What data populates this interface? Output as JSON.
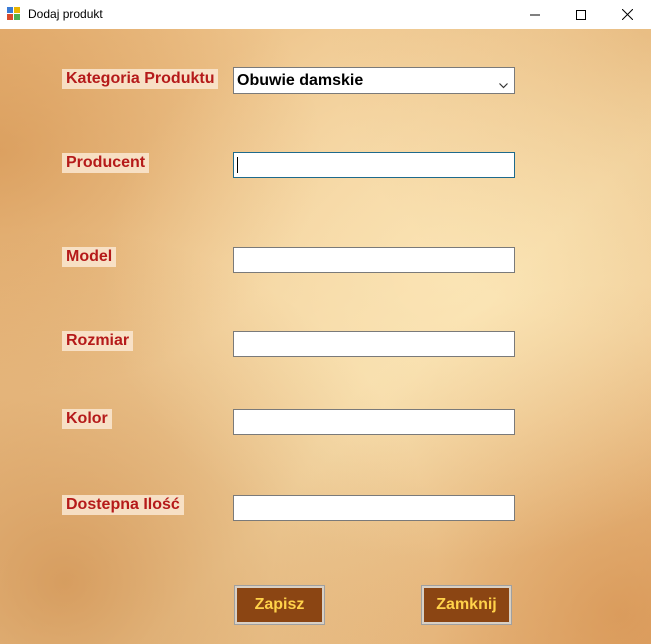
{
  "window": {
    "title": "Dodaj produkt"
  },
  "form": {
    "category": {
      "label": "Kategoria Produktu",
      "selected": "Obuwie damskie"
    },
    "producer": {
      "label": "Producent",
      "value": ""
    },
    "model": {
      "label": "Model",
      "value": ""
    },
    "size": {
      "label": "Rozmiar",
      "value": ""
    },
    "color": {
      "label": "Kolor",
      "value": ""
    },
    "quantity": {
      "label": "Dostepna Ilość",
      "value": ""
    }
  },
  "buttons": {
    "save": "Zapisz",
    "close": "Zamknij"
  },
  "colors": {
    "label_text": "#b51a1a",
    "button_bg": "#8b4513",
    "button_text": "#ffd24a"
  },
  "icons": {
    "app": "app-icon",
    "minimize": "minimize-icon",
    "maximize": "maximize-icon",
    "close": "close-icon",
    "dropdown": "chevron-down-icon"
  }
}
